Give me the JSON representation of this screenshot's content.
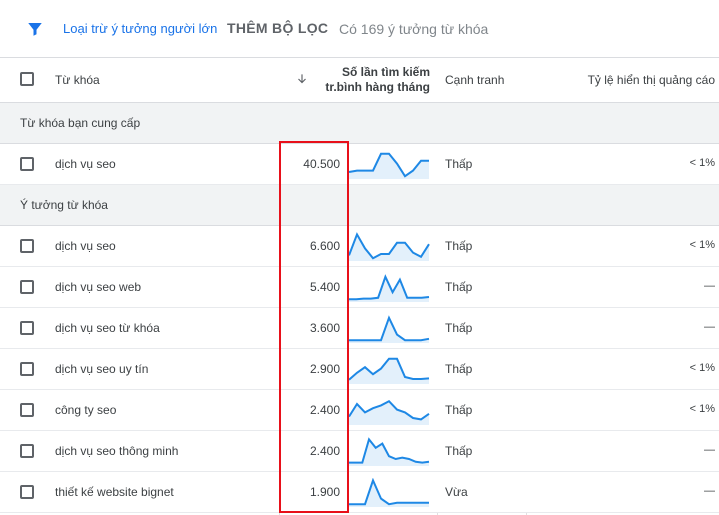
{
  "filter_bar": {
    "exclude_adult_label": "Loại trừ ý tưởng người lớn",
    "add_filter_label": "THÊM BỘ LỌC",
    "result_count": "Có 169 ý tưởng từ khóa"
  },
  "columns": {
    "keyword": "Từ khóa",
    "volume_line1": "Số lần tìm kiếm",
    "volume_line2": "tr.bình hàng tháng",
    "competition": "Cạnh tranh",
    "impression_share": "Tỷ lệ hiển thị quảng cáo"
  },
  "sections": {
    "provided": "Từ khóa bạn cung cấp",
    "ideas": "Ý tưởng từ khóa"
  },
  "provided_rows": [
    {
      "keyword": "dịch vụ seo",
      "volume": "40.500",
      "competition": "Thấp",
      "share": "< 1%",
      "trend": [
        0.25,
        0.3,
        0.3,
        0.3,
        0.9,
        0.9,
        0.55,
        0.1,
        0.3,
        0.65,
        0.65
      ]
    }
  ],
  "idea_rows": [
    {
      "keyword": "dịch vụ seo",
      "volume": "6.600",
      "competition": "Thấp",
      "share": "< 1%",
      "trend": [
        0.2,
        0.95,
        0.45,
        0.1,
        0.25,
        0.25,
        0.65,
        0.65,
        0.3,
        0.15,
        0.6
      ]
    },
    {
      "keyword": "dịch vụ seo web",
      "volume": "5.400",
      "competition": "Thấp",
      "share": "—",
      "trend": [
        0.1,
        0.1,
        0.12,
        0.12,
        0.15,
        0.9,
        0.35,
        0.8,
        0.15,
        0.15,
        0.15,
        0.18
      ]
    },
    {
      "keyword": "dịch vụ seo từ khóa",
      "volume": "3.600",
      "competition": "Thấp",
      "share": "—",
      "trend": [
        0.1,
        0.1,
        0.1,
        0.1,
        0.1,
        0.9,
        0.3,
        0.1,
        0.1,
        0.1,
        0.15
      ]
    },
    {
      "keyword": "dịch vụ seo uy tín",
      "volume": "2.900",
      "competition": "Thấp",
      "share": "< 1%",
      "trend": [
        0.15,
        0.4,
        0.6,
        0.35,
        0.55,
        0.9,
        0.9,
        0.25,
        0.18,
        0.18,
        0.2
      ]
    },
    {
      "keyword": "công ty seo",
      "volume": "2.400",
      "competition": "Thấp",
      "share": "< 1%",
      "trend": [
        0.3,
        0.75,
        0.45,
        0.6,
        0.7,
        0.85,
        0.55,
        0.45,
        0.25,
        0.2,
        0.4
      ]
    },
    {
      "keyword": "dịch vụ seo thông minh",
      "volume": "2.400",
      "competition": "Thấp",
      "share": "—",
      "trend": [
        0.12,
        0.12,
        0.12,
        0.95,
        0.65,
        0.8,
        0.35,
        0.25,
        0.3,
        0.25,
        0.15,
        0.12,
        0.15
      ]
    },
    {
      "keyword": "thiết kế website bignet",
      "volume": "1.900",
      "competition": "Vừa",
      "share": "—",
      "trend": [
        0.1,
        0.1,
        0.1,
        0.95,
        0.3,
        0.1,
        0.15,
        0.15,
        0.15,
        0.15,
        0.15
      ]
    }
  ],
  "colors": {
    "accent": "#1a73e8",
    "spark_line": "#1e88e5",
    "spark_fill": "#e3f0fb",
    "highlight": "#e8101a"
  },
  "icons": {
    "filter": "filter-icon",
    "sort": "arrow-down-icon"
  }
}
